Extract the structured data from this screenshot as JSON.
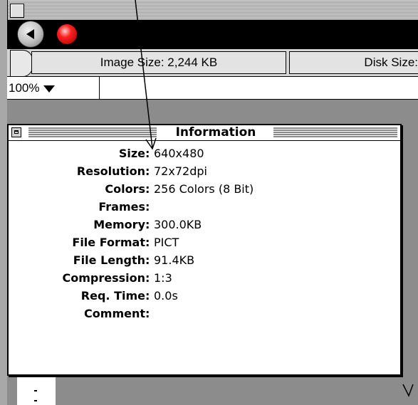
{
  "window": {
    "title_icon": "window-tab",
    "back_icon": "back-arrow-icon",
    "record_icon": "red-record-icon"
  },
  "status": {
    "image_size": "Image Size: 2,244 KB",
    "disk_size": "Disk Size:"
  },
  "zoom": {
    "value": "100%"
  },
  "info": {
    "title": "Information",
    "rows": [
      {
        "label": "Size",
        "value": "640x480"
      },
      {
        "label": "Resolution",
        "value": "72x72dpi"
      },
      {
        "label": "Colors",
        "value": "256 Colors (8 Bit)"
      },
      {
        "label": "Frames",
        "value": ""
      },
      {
        "label": "Memory",
        "value": "300.0KB"
      },
      {
        "label": "File Format",
        "value": "PICT"
      },
      {
        "label": "File Length",
        "value": "91.4KB"
      },
      {
        "label": "Compression",
        "value": "1:3"
      },
      {
        "label": "Req. Time",
        "value": "0.0s"
      },
      {
        "label": "Comment",
        "value": ""
      }
    ]
  },
  "colors": {
    "accent_red": "#ff2020",
    "panel_gray": "#8c8c8c",
    "bar_black": "#000000"
  }
}
